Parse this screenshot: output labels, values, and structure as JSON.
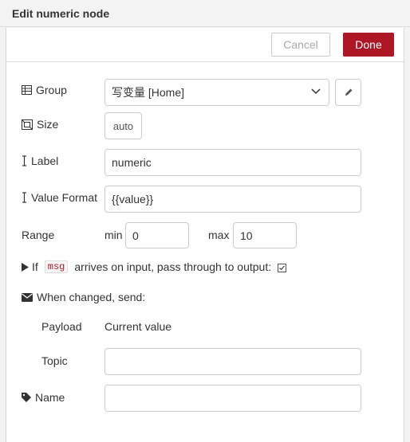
{
  "dialog": {
    "title": "Edit numeric node"
  },
  "toolbar": {
    "cancel_label": "Cancel",
    "done_label": "Done"
  },
  "form": {
    "group": {
      "label": "Group",
      "value": "写变量 [Home]"
    },
    "size": {
      "label": "Size",
      "value": "auto"
    },
    "label_field": {
      "label": "Label",
      "value": "numeric"
    },
    "value_format": {
      "label": "Value Format",
      "value": "{{value}}"
    },
    "range": {
      "label": "Range",
      "min_label": "min",
      "min_value": "0",
      "max_label": "max",
      "max_value": "10"
    },
    "pass_through": {
      "prefix": "If",
      "tag": "msg",
      "text": "arrives on input, pass through to output:",
      "checked": true
    },
    "when_changed": {
      "label": "When changed, send:"
    },
    "payload": {
      "label": "Payload",
      "value": "Current value"
    },
    "topic": {
      "label": "Topic",
      "value": ""
    },
    "name": {
      "label": "Name",
      "value": ""
    }
  },
  "icons": {
    "group": "table-icon",
    "size": "resize-icon",
    "label": "i-cursor-icon",
    "pass": "caret-right-icon",
    "send": "envelope-icon",
    "name": "tag-icon",
    "edit": "pencil-icon",
    "dropdown": "chevron-down-icon"
  }
}
